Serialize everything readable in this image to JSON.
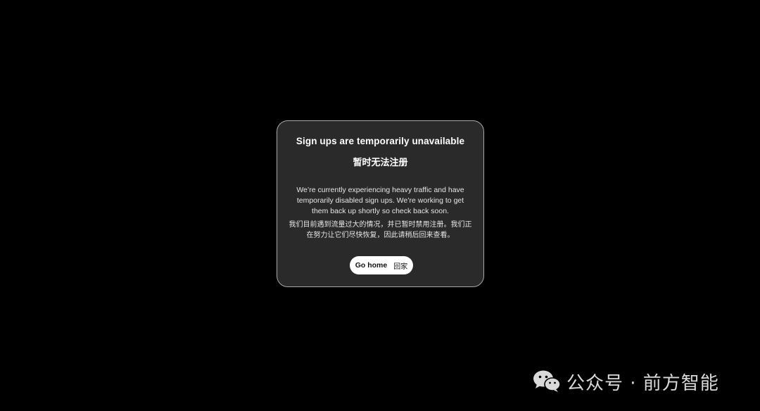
{
  "dialog": {
    "title_en": "Sign ups are temporarily unavailable",
    "title_zh": "暂时无法注册",
    "body_en": "We’re currently experiencing heavy traffic and have temporarily disabled sign ups. We’re working to get them back up shortly so check back soon.",
    "body_zh": "我们目前遇到流量过大的情况，并已暂时禁用注册。我们正在努力让它们尽快恢复，因此请稍后回来查看。",
    "button_en": "Go home",
    "button_zh": "回家"
  },
  "watermark": {
    "icon": "wechat-icon",
    "text": "公众号 · 前方智能"
  },
  "colors": {
    "page_background": "#000000",
    "dialog_background": "#2a2a2a",
    "dialog_border": "#a8a8a8",
    "button_background": "#ffffff",
    "button_text": "#111111"
  }
}
